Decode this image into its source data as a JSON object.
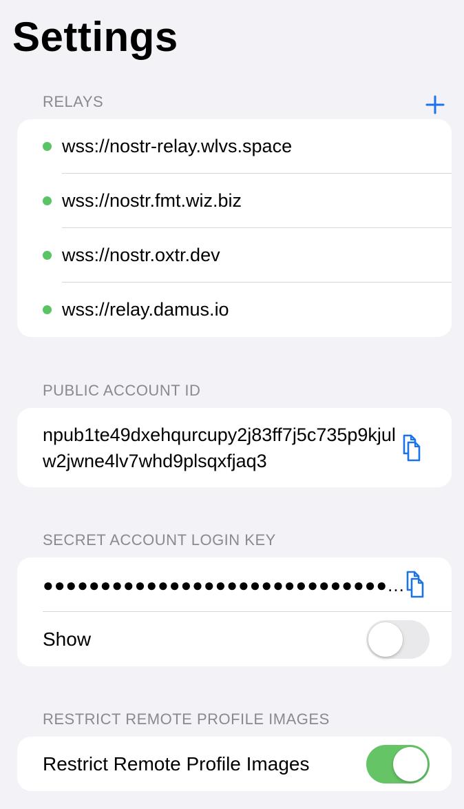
{
  "page": {
    "title": "Settings"
  },
  "relays": {
    "header": "RELAYS",
    "add_icon": "plus-icon",
    "status_color": "#5ac464",
    "items": [
      {
        "url": "wss://nostr-relay.wlvs.space"
      },
      {
        "url": "wss://nostr.fmt.wiz.biz"
      },
      {
        "url": "wss://nostr.oxtr.dev"
      },
      {
        "url": "wss://relay.damus.io"
      }
    ]
  },
  "public_account": {
    "header": "PUBLIC ACCOUNT ID",
    "value": "npub1te49dxehqurcupy2j83ff7j5c735p9kjulw2jwne4lv7whd9plsqxfjaq3",
    "copy_icon": "copy-icon"
  },
  "secret_key": {
    "header": "SECRET ACCOUNT LOGIN KEY",
    "masked_value": "●●●●●●●●●●●●●●●●●●●●●●●●●●●●●●...",
    "copy_icon": "copy-icon",
    "show_label": "Show",
    "show_enabled": false
  },
  "restrict_images": {
    "header": "RESTRICT REMOTE PROFILE IMAGES",
    "label": "Restrict Remote Profile Images",
    "enabled": true
  },
  "colors": {
    "accent": "#1a73e8",
    "background": "#f2f2f7",
    "toggle_on": "#65c466",
    "toggle_off": "#e9e9eb",
    "header_text": "#8a8a8e"
  }
}
